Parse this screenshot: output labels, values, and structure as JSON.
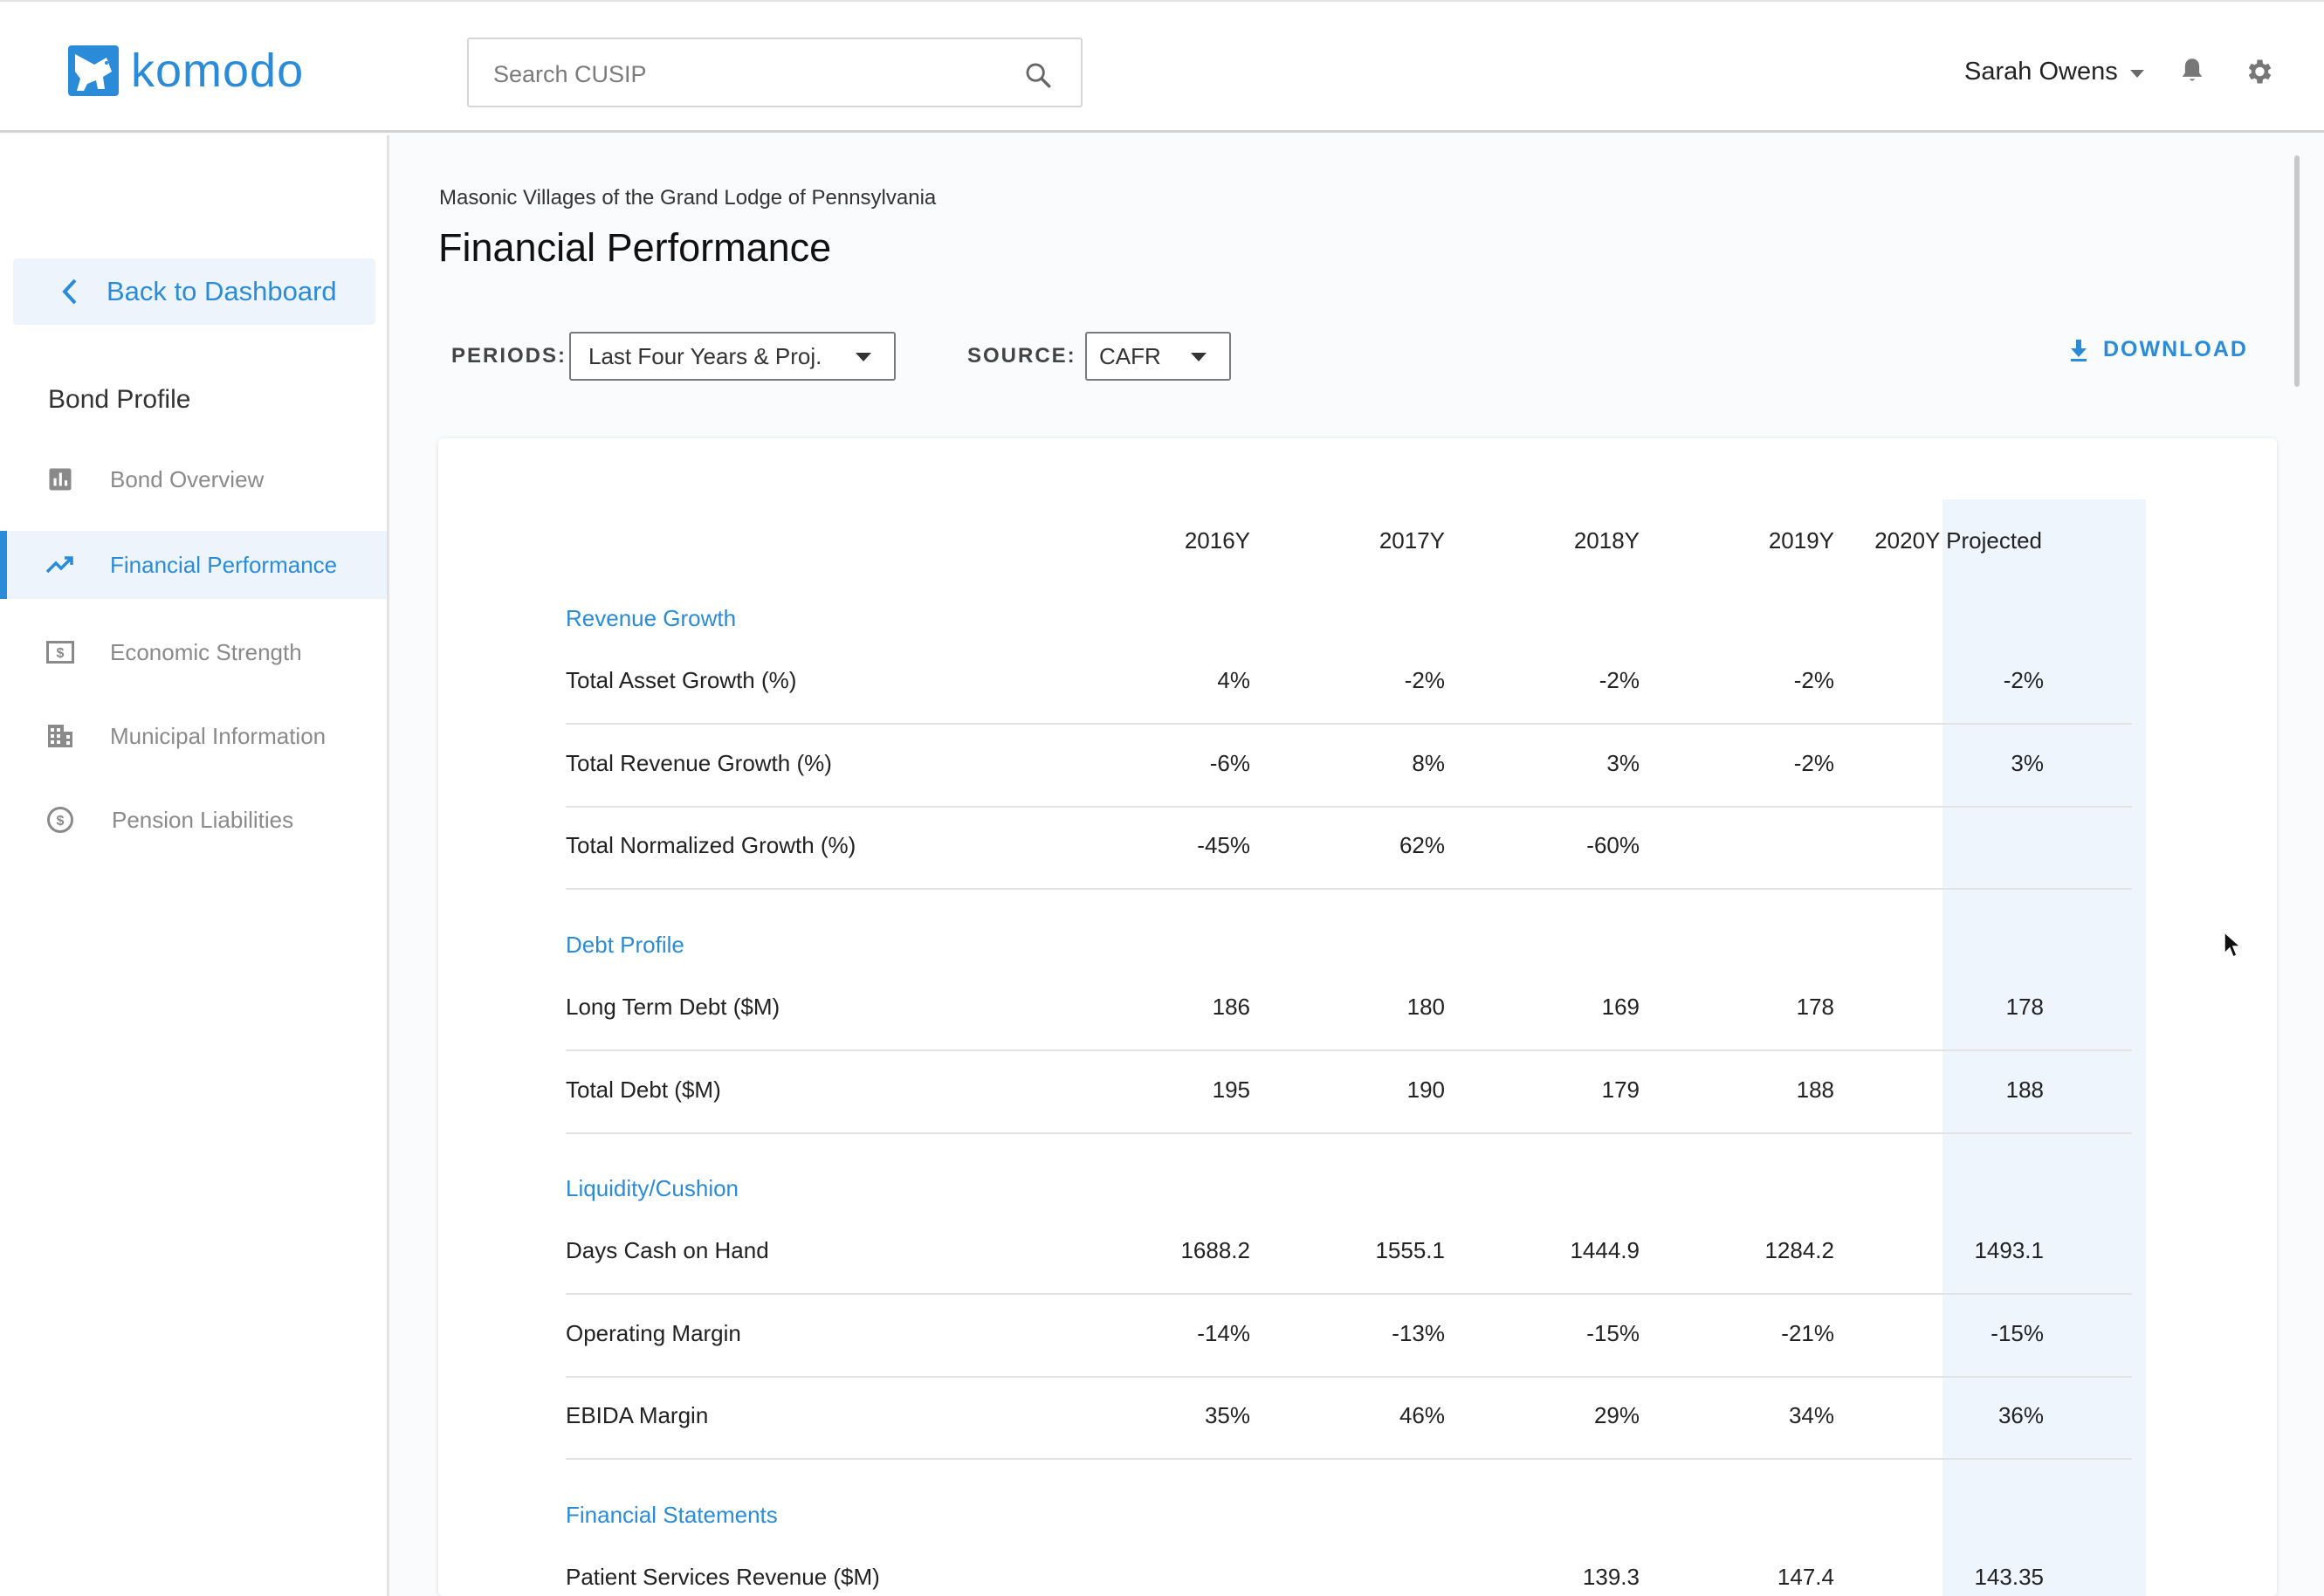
{
  "app": {
    "brand": "komodo",
    "brand_color": "#2a8bd9",
    "search_placeholder": "Search CUSIP",
    "user_name": "Sarah Owens"
  },
  "sidebar": {
    "back_label": "Back to Dashboard",
    "section_title": "Bond Profile",
    "items": [
      {
        "label": "Bond Overview",
        "icon": "bar-chart-icon",
        "active": false
      },
      {
        "label": "Financial Performance",
        "icon": "trending-up-icon",
        "active": true
      },
      {
        "label": "Economic Strength",
        "icon": "dollar-bill-icon",
        "active": false
      },
      {
        "label": "Municipal Information",
        "icon": "building-icon",
        "active": false
      },
      {
        "label": "Pension Liabilities",
        "icon": "dollar-circle-icon",
        "active": false
      }
    ]
  },
  "main": {
    "org_name": "Masonic Villages of the Grand Lodge of Pennsylvania",
    "title": "Financial Performance",
    "periods_label": "PERIODS:",
    "periods_value": "Last Four Years & Proj.",
    "source_label": "SOURCE:",
    "source_value": "CAFR",
    "download_label": "DOWNLOAD"
  },
  "table": {
    "columns": [
      "2016Y",
      "2017Y",
      "2018Y",
      "2019Y",
      "2020Y Projected"
    ],
    "sections": [
      {
        "title": "Revenue Growth",
        "rows": [
          {
            "label": "Total Asset Growth (%)",
            "values": [
              "4%",
              "-2%",
              "-2%",
              "-2%",
              "-2%"
            ]
          },
          {
            "label": "Total Revenue Growth (%)",
            "values": [
              "-6%",
              "8%",
              "3%",
              "-2%",
              "3%"
            ]
          },
          {
            "label": "Total Normalized Growth (%)",
            "values": [
              "-45%",
              "62%",
              "-60%",
              "",
              ""
            ]
          }
        ]
      },
      {
        "title": "Debt Profile",
        "rows": [
          {
            "label": "Long Term Debt ($M)",
            "values": [
              "186",
              "180",
              "169",
              "178",
              "178"
            ]
          },
          {
            "label": "Total Debt ($M)",
            "values": [
              "195",
              "190",
              "179",
              "188",
              "188"
            ]
          }
        ]
      },
      {
        "title": "Liquidity/Cushion",
        "rows": [
          {
            "label": "Days Cash on Hand",
            "values": [
              "1688.2",
              "1555.1",
              "1444.9",
              "1284.2",
              "1493.1"
            ]
          },
          {
            "label": "Operating Margin",
            "values": [
              "-14%",
              "-13%",
              "-15%",
              "-21%",
              "-15%"
            ]
          },
          {
            "label": "EBIDA Margin",
            "values": [
              "35%",
              "46%",
              "29%",
              "34%",
              "36%"
            ]
          }
        ]
      },
      {
        "title": "Financial Statements",
        "rows": [
          {
            "label": "Patient Services Revenue ($M)",
            "values": [
              "",
              "",
              "139.3",
              "147.4",
              "143.35"
            ]
          }
        ]
      }
    ]
  }
}
